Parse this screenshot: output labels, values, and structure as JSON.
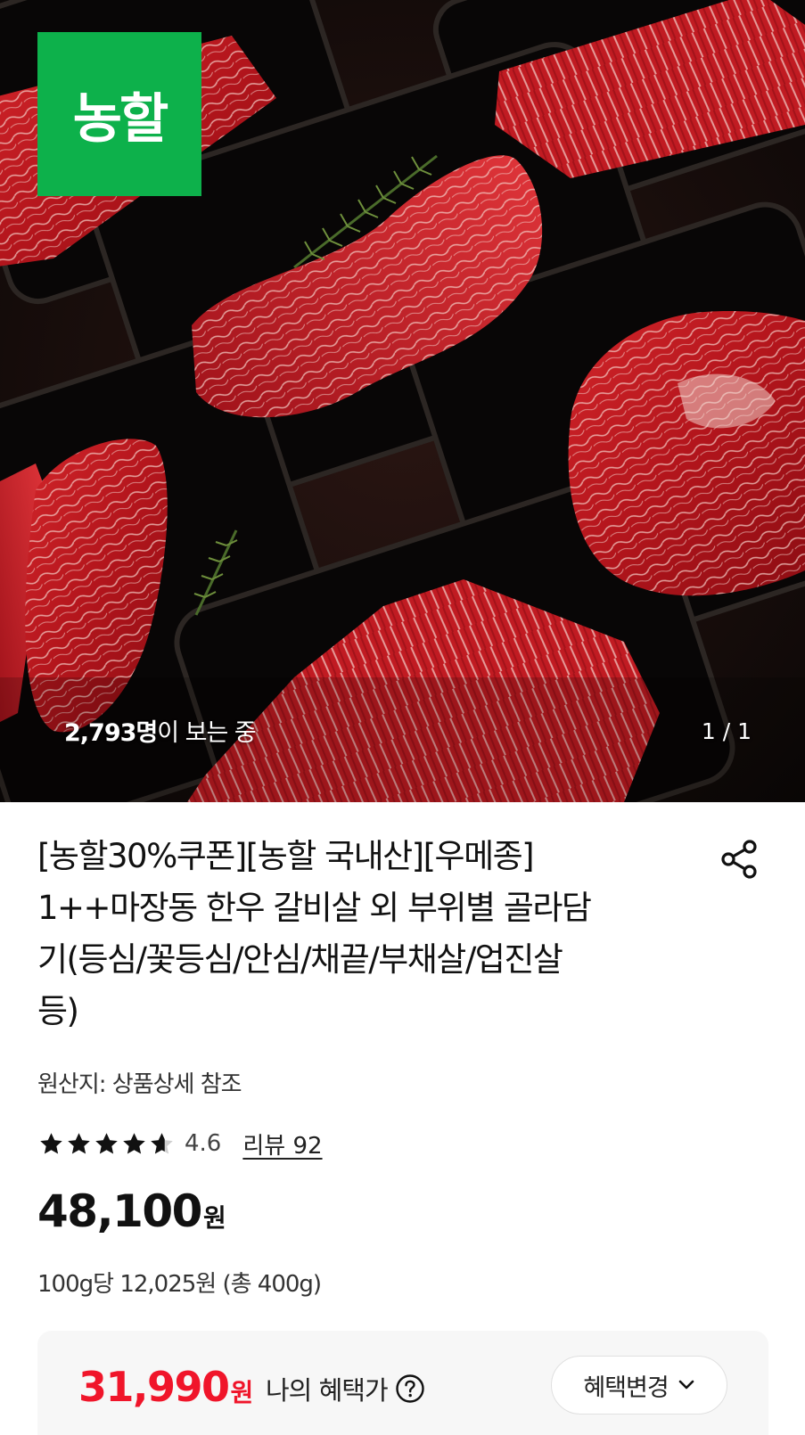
{
  "hero": {
    "logo_text": "농할",
    "viewers_count": "2,793명",
    "viewers_suffix": "이 보는 중",
    "pager": "1 / 1"
  },
  "product": {
    "title_lines": [
      "[농할30%쿠폰][농할 국내산][우메종]",
      "1++마장동 한우 갈비살 외 부위별 골라담",
      "기(등심/꽃등심/안심/채끝/부채살/업진살",
      "등)"
    ],
    "origin": "원산지: 상품상세 참조",
    "rating": 4.6,
    "rating_text": "4.6",
    "review_link": "리뷰 92",
    "price": "48,100",
    "price_unit": "원",
    "unit_price": "100g당 12,025원 (총 400g)"
  },
  "benefit": {
    "price": "31,990",
    "price_unit": "원",
    "label": "나의 혜택가",
    "change_button": "혜택변경"
  },
  "colors": {
    "brand_green": "#0db14b",
    "benefit_red": "#f0152a"
  },
  "icons": [
    "share-icon",
    "star-icon",
    "question-circle-icon",
    "chevron-down-icon"
  ]
}
